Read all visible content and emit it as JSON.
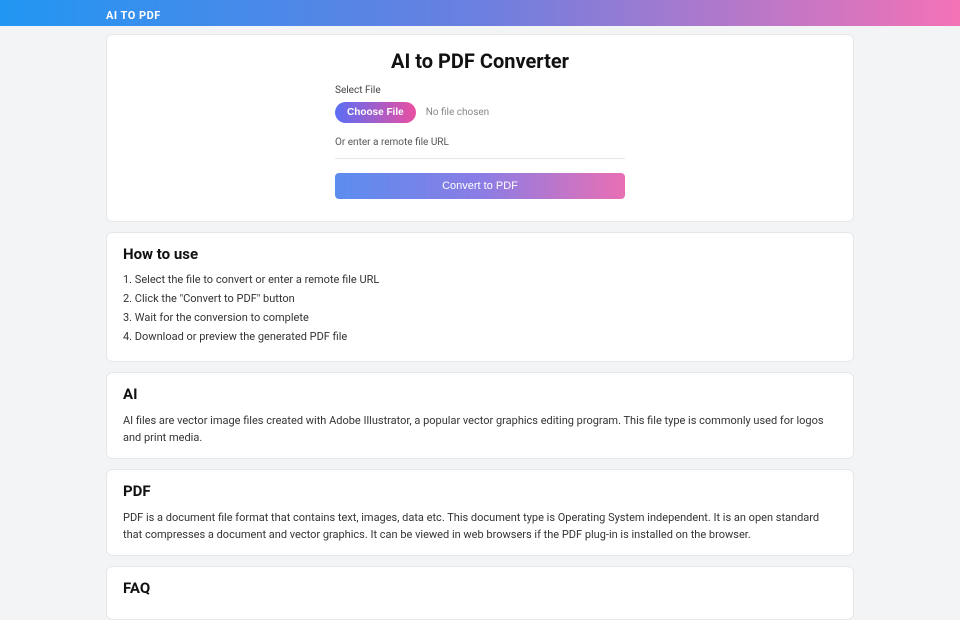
{
  "topbar": {
    "logo": "AI TO PDF"
  },
  "main": {
    "title": "AI to PDF Converter",
    "select_file_label": "Select File",
    "choose_file_btn": "Choose File",
    "no_file_text": "No file chosen",
    "url_label": "Or enter a remote file URL",
    "convert_btn": "Convert to PDF"
  },
  "howto": {
    "title": "How to use",
    "steps": [
      "1. Select the file to convert or enter a remote file URL",
      "2. Click the \"Convert to PDF\" button",
      "3. Wait for the conversion to complete",
      "4. Download or preview the generated PDF file"
    ]
  },
  "ai_section": {
    "title": "AI",
    "body": "AI files are vector image files created with Adobe Illustrator, a popular vector graphics editing program. This file type is commonly used for logos and print media."
  },
  "pdf_section": {
    "title": "PDF",
    "body": "PDF is a document file format that contains text, images, data etc. This document type is Operating System independent. It is an open standard that compresses a document and vector graphics. It can be viewed in web browsers if the PDF plug-in is installed on the browser."
  },
  "faq_section": {
    "title": "FAQ"
  }
}
